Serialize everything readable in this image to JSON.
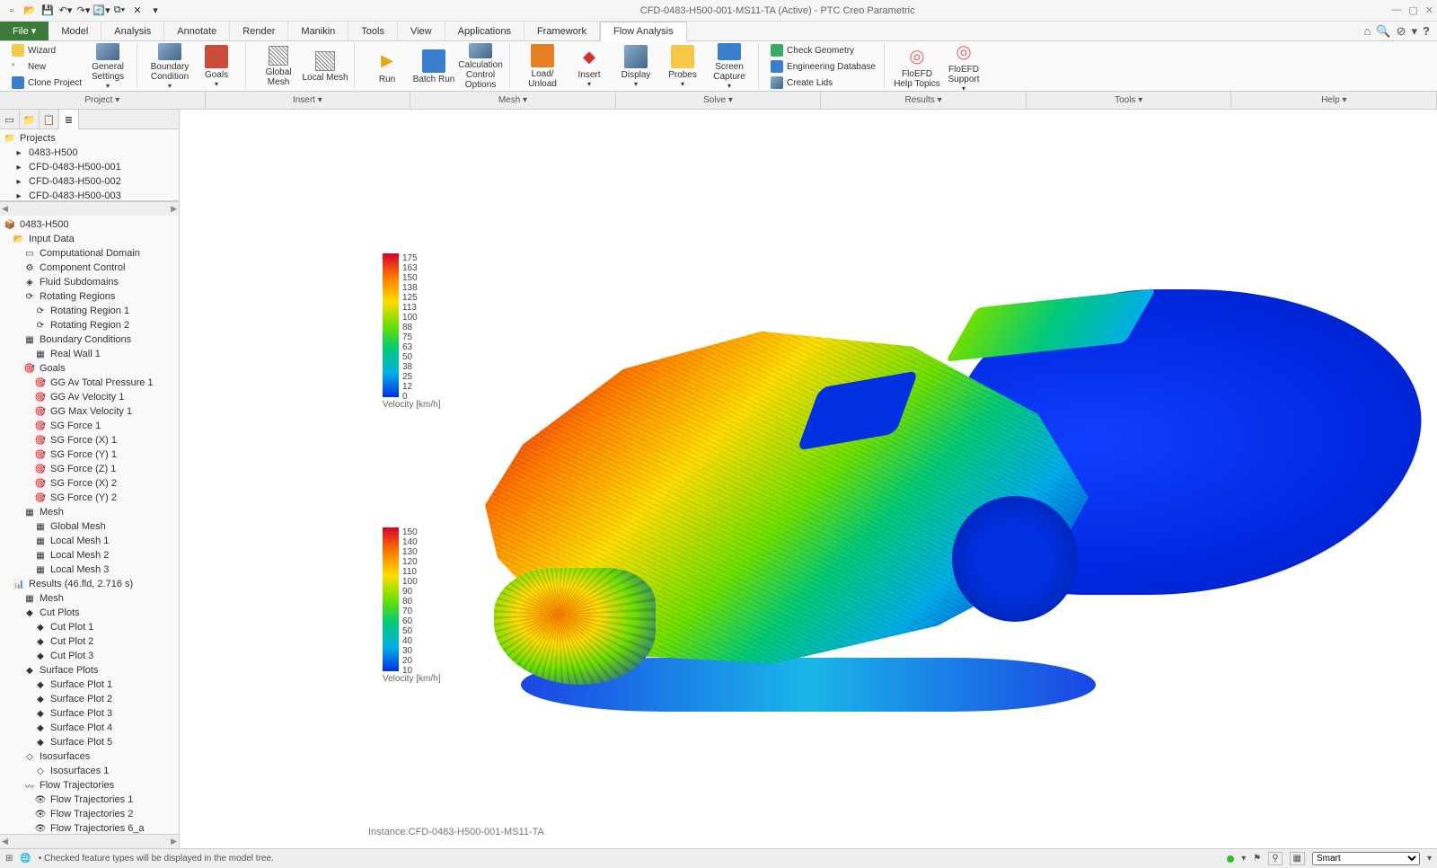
{
  "window": {
    "title": "CFD-0483-H500-001-MS11-TA (Active) - PTC Creo Parametric"
  },
  "menu": {
    "file": "File ▾",
    "tabs": [
      "Model",
      "Analysis",
      "Annotate",
      "Render",
      "Manikin",
      "Tools",
      "View",
      "Applications",
      "Framework",
      "Flow Analysis"
    ],
    "active": 9
  },
  "ribbon": {
    "wizard": "Wizard",
    "new": "New",
    "clone": "Clone Project",
    "general_settings": "General Settings",
    "boundary_condition": "Boundary Condition",
    "goals": "Goals",
    "global_mesh": "Global Mesh",
    "local_mesh": "Local Mesh",
    "run": "Run",
    "batch_run": "Batch Run",
    "calc_options": "Calculation Control Options",
    "load_unload": "Load/ Unload",
    "insert": "Insert",
    "display": "Display",
    "probes": "Probes",
    "screen_capture": "Screen Capture",
    "check_geom": "Check Geometry",
    "eng_db": "Engineering Database",
    "create_lids": "Create Lids",
    "help_topics": "FloEFD Help Topics",
    "support": "FloEFD Support"
  },
  "subribbon": [
    "Project ▾",
    "Insert ▾",
    "Mesh ▾",
    "Solve ▾",
    "Results ▾",
    "Tools ▾",
    "Help ▾"
  ],
  "projects": {
    "header": "Projects",
    "items": [
      "0483-H500",
      "CFD-0483-H500-001",
      "CFD-0483-H500-002",
      "CFD-0483-H500-003"
    ]
  },
  "tree": {
    "root": "0483-H500",
    "input_data": "Input Data",
    "comp_domain": "Computational Domain",
    "comp_control": "Component Control",
    "fluid_sub": "Fluid Subdomains",
    "rotating_regions": "Rotating Regions",
    "rr1": "Rotating Region 1",
    "rr2": "Rotating Region 2",
    "boundary_cond": "Boundary Conditions",
    "real_wall": "Real Wall 1",
    "goals": "Goals",
    "goal_items": [
      "GG Av Total Pressure 1",
      "GG Av Velocity 1",
      "GG Max Velocity 1",
      "SG Force 1",
      "SG Force (X) 1",
      "SG Force (Y) 1",
      "SG Force (Z) 1",
      "SG Force (X) 2",
      "SG Force (Y) 2"
    ],
    "mesh": "Mesh",
    "global_mesh": "Global Mesh",
    "local_mesh_items": [
      "Local Mesh 1",
      "Local Mesh 2",
      "Local Mesh 3"
    ],
    "results": "Results (46.fld, 2.716 s)",
    "res_mesh": "Mesh",
    "cut_plots": "Cut Plots",
    "cut_plot_items": [
      "Cut Plot 1",
      "Cut Plot 2",
      "Cut Plot 3"
    ],
    "surface_plots": "Surface Plots",
    "surface_plot_items": [
      "Surface Plot 1",
      "Surface Plot 2",
      "Surface Plot 3",
      "Surface Plot 4",
      "Surface Plot 5"
    ],
    "isosurfaces": "Isosurfaces",
    "iso_item": "Isosurfaces 1",
    "flow_traj": "Flow Trajectories",
    "flow_traj_items": [
      "Flow Trajectories 1",
      "Flow Trajectories 2",
      "Flow Trajectories 6_a"
    ]
  },
  "legend1": {
    "caption": "Velocity [km/h]",
    "ticks": [
      "175",
      "163",
      "150",
      "138",
      "125",
      "113",
      "100",
      "88",
      "75",
      "63",
      "50",
      "38",
      "25",
      "12",
      "0"
    ]
  },
  "legend2": {
    "caption": "Velocity [km/h]",
    "ticks": [
      "150",
      "140",
      "130",
      "120",
      "110",
      "100",
      "90",
      "80",
      "70",
      "60",
      "50",
      "40",
      "30",
      "20",
      "10"
    ]
  },
  "instance": "Instance:CFD-0483-H500-001-MS11-TA",
  "status": {
    "msg": "• Checked feature types will be displayed in the model tree.",
    "filter": "Smart"
  }
}
